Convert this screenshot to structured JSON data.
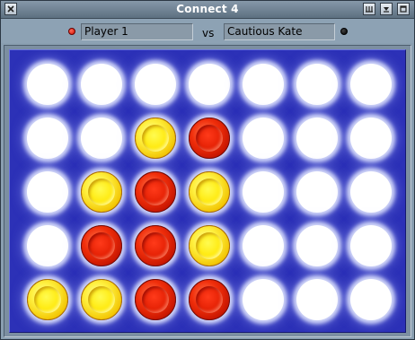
{
  "window": {
    "title": "Connect 4",
    "buttons": {
      "close": "close-icon",
      "menu": "menu-icon",
      "minimize": "minimize-icon",
      "maximize": "maximize-icon"
    }
  },
  "players": {
    "player1": {
      "name": "Player 1",
      "color": "#e01c00"
    },
    "vs_label": "vs",
    "player2": {
      "name": "Cautious Kate",
      "color": "#000000"
    }
  },
  "board": {
    "columns": 7,
    "rows": 5,
    "colors": {
      "background": "#2c31b7",
      "red": "#e01c00",
      "yellow": "#ffe600",
      "empty": "#ffffff"
    },
    "cells": [
      [
        "empty",
        "empty",
        "empty",
        "empty",
        "empty",
        "empty",
        "empty"
      ],
      [
        "empty",
        "empty",
        "yellow",
        "red",
        "empty",
        "empty",
        "empty"
      ],
      [
        "empty",
        "yellow",
        "red",
        "yellow",
        "empty",
        "empty",
        "empty"
      ],
      [
        "empty",
        "red",
        "red",
        "yellow",
        "empty",
        "empty",
        "empty"
      ],
      [
        "yellow",
        "yellow",
        "red",
        "red",
        "empty",
        "empty",
        "empty"
      ]
    ]
  }
}
